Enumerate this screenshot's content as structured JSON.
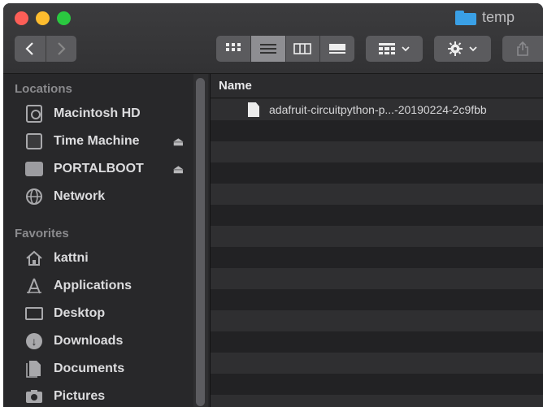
{
  "window": {
    "title": "temp"
  },
  "toolbar": {
    "back_icon": "chevron-left-icon",
    "forward_icon": "chevron-right-icon",
    "view_modes": [
      "icon-view",
      "list-view",
      "column-view",
      "gallery-view"
    ],
    "active_view": "list-view"
  },
  "sidebar": {
    "locations_header": "Locations",
    "locations": [
      {
        "label": "Macintosh HD",
        "icon": "hard-drive-icon",
        "eject": false
      },
      {
        "label": "Time Machine",
        "icon": "time-machine-icon",
        "eject": true
      },
      {
        "label": "PORTALBOOT",
        "icon": "external-drive-icon",
        "eject": true
      },
      {
        "label": "Network",
        "icon": "network-icon",
        "eject": false
      }
    ],
    "favorites_header": "Favorites",
    "favorites": [
      {
        "label": "kattni",
        "icon": "home-icon"
      },
      {
        "label": "Applications",
        "icon": "applications-icon"
      },
      {
        "label": "Desktop",
        "icon": "desktop-icon"
      },
      {
        "label": "Downloads",
        "icon": "downloads-icon"
      },
      {
        "label": "Documents",
        "icon": "documents-icon"
      },
      {
        "label": "Pictures",
        "icon": "pictures-icon"
      }
    ]
  },
  "content": {
    "column_name": "Name",
    "files": [
      {
        "name": "adafruit-circuitpython-p...-20190224-2c9fbb"
      }
    ]
  },
  "colors": {
    "accent_folder": "#3aa0e6",
    "close": "#fc5e57",
    "minimize": "#fdbc2e",
    "zoom": "#2ac940"
  }
}
